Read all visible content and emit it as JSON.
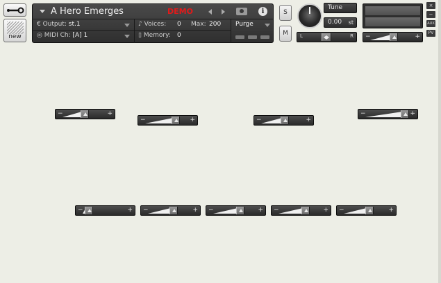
{
  "header": {
    "instrument_name": "A Hero Emerges",
    "demo_label": "DEMO",
    "output_label": "Output:",
    "output_value": "st.1",
    "midi_label": "MIDI Ch:",
    "midi_value": "[A]  1",
    "voices_label": "Voices:",
    "voices_value": "0",
    "max_label": "Max:",
    "max_value": "200",
    "memory_label": "Memory:",
    "memory_value": "0",
    "purge_label": "Purge",
    "info_glyph": "i"
  },
  "tools": {
    "new_label": "new"
  },
  "solo_mute": {
    "solo_label": "S",
    "mute_label": "M"
  },
  "tune": {
    "label": "Tune",
    "value": "0.00",
    "unit": "st"
  },
  "pan": {
    "left_label": "L",
    "right_label": "R"
  },
  "side_buttons": {
    "close": "×",
    "minimize": "−",
    "aux": "AUX",
    "pv": "PV"
  },
  "sliders": {
    "minus": "−",
    "plus": "+",
    "levels": {
      "main_volume": 0.55,
      "row1_1": 0.5,
      "row1_2": 0.75,
      "row1_3": 0.55,
      "row1_4": 1.0,
      "row2_1": 0.05,
      "row2_2": 0.6,
      "row2_3": 0.65,
      "row2_4": 0.65,
      "row2_5": 0.6
    }
  },
  "colors": {
    "background": "#edeee6",
    "panel": "#3a3a3a",
    "demo_red": "#e21a1a"
  }
}
